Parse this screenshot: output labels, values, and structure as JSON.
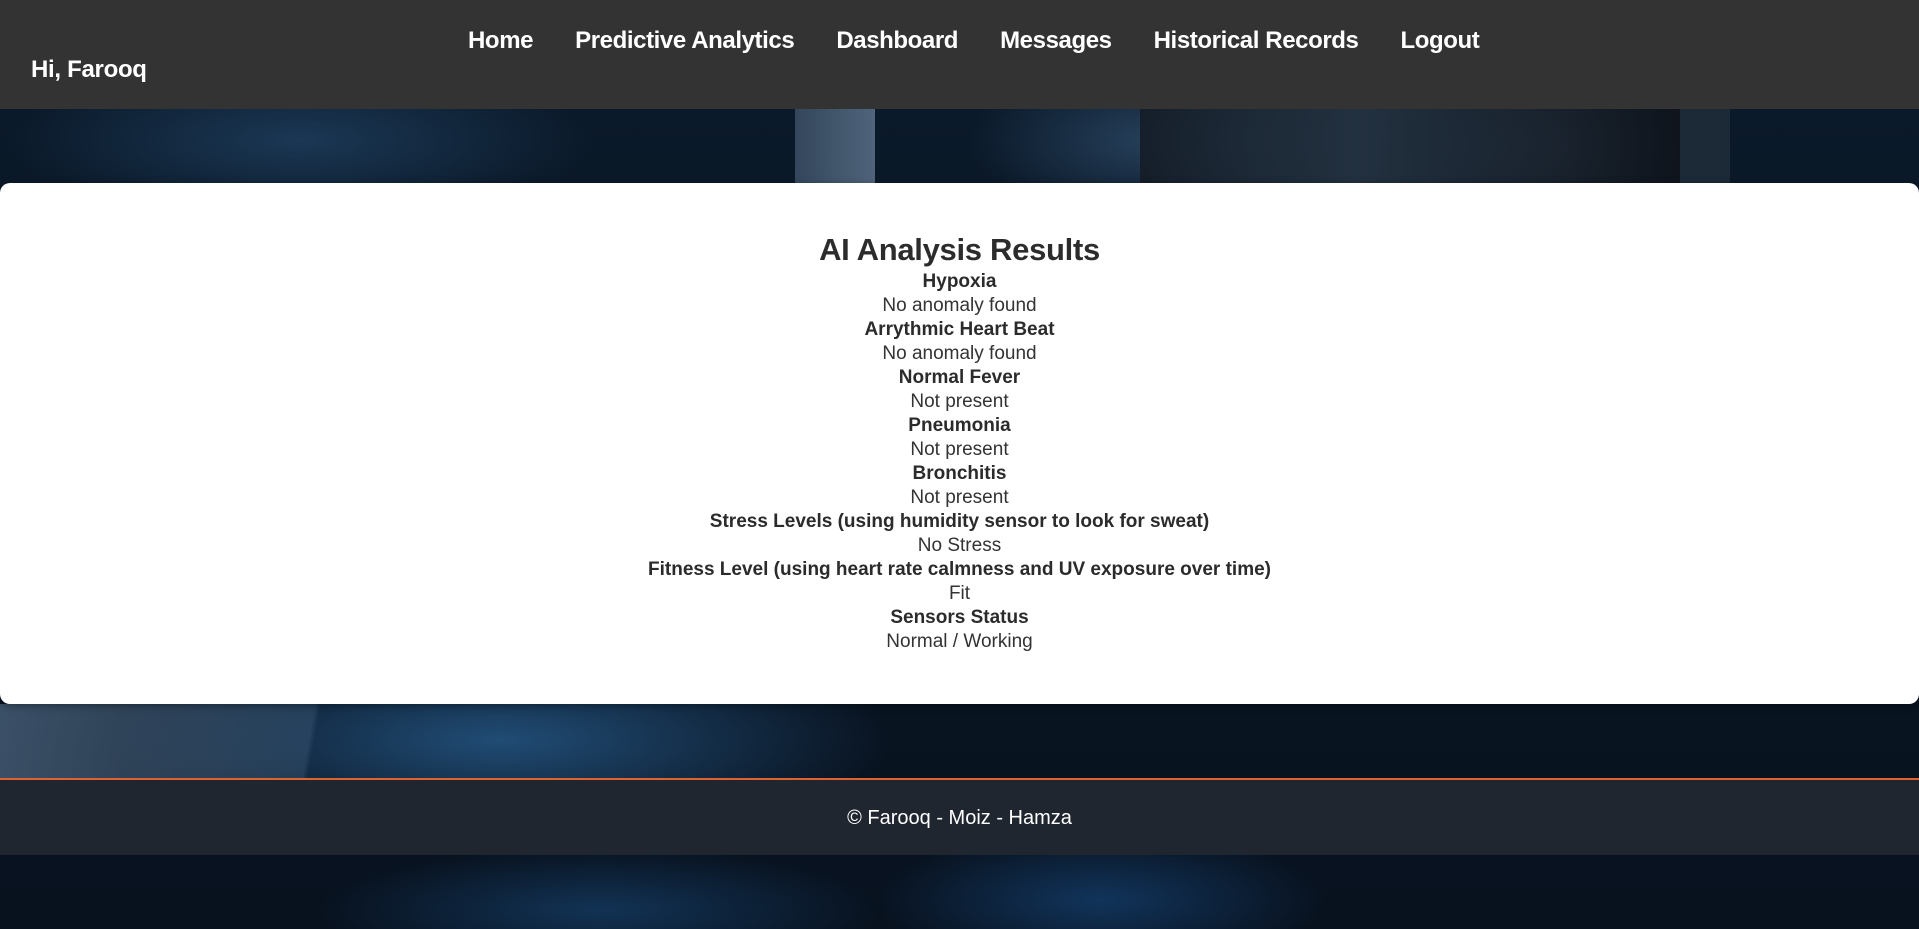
{
  "header": {
    "greeting": "Hi, Farooq",
    "nav": [
      {
        "label": "Home"
      },
      {
        "label": "Predictive Analytics"
      },
      {
        "label": "Dashboard"
      },
      {
        "label": "Messages"
      },
      {
        "label": "Historical Records"
      },
      {
        "label": "Logout"
      }
    ]
  },
  "main": {
    "title": "AI Analysis Results",
    "results": [
      {
        "label": "Hypoxia",
        "value": "No anomaly found"
      },
      {
        "label": "Arrythmic Heart Beat",
        "value": "No anomaly found"
      },
      {
        "label": "Normal Fever",
        "value": "Not present"
      },
      {
        "label": "Pneumonia",
        "value": "Not present"
      },
      {
        "label": "Bronchitis",
        "value": "Not present"
      },
      {
        "label": "Stress Levels (using humidity sensor to look for sweat)",
        "value": "No Stress"
      },
      {
        "label": "Fitness Level (using heart rate calmness and UV exposure over time)",
        "value": "Fit"
      },
      {
        "label": "Sensors Status",
        "value": "Normal / Working"
      }
    ]
  },
  "footer": {
    "text": "© Farooq - Moiz - Hamza"
  },
  "colors": {
    "header_bg": "#333333",
    "footer_bg": "#1f2630",
    "footer_accent": "#e0632f",
    "card_bg": "#ffffff"
  }
}
